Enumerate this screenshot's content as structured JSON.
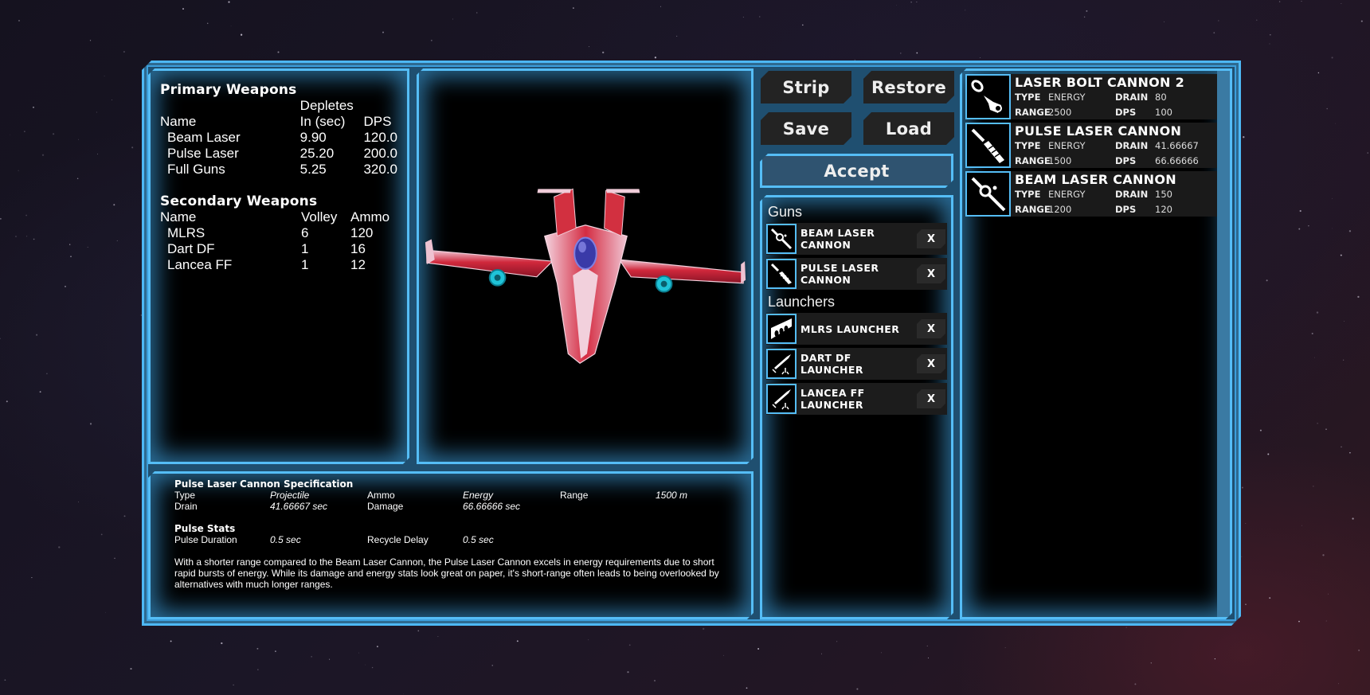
{
  "colors": {
    "frame_accent": "#55bdf6",
    "panel_bg": "#000000",
    "button_bg": "#232323",
    "accept_bg": "#2f5370"
  },
  "primary_weapons": {
    "title": "Primary Weapons",
    "header_top": [
      "",
      "Depletes",
      ""
    ],
    "headers": [
      "Name",
      "In (sec)",
      "DPS"
    ],
    "rows": [
      {
        "name": "Beam Laser",
        "depletes": "9.90",
        "dps": "120.0"
      },
      {
        "name": "Pulse Laser",
        "depletes": "25.20",
        "dps": "200.0"
      },
      {
        "name": "Full Guns",
        "depletes": "5.25",
        "dps": "320.0"
      }
    ]
  },
  "secondary_weapons": {
    "title": "Secondary Weapons",
    "headers": [
      "Name",
      "Volley",
      "Ammo"
    ],
    "rows": [
      {
        "name": "MLRS",
        "volley": "6",
        "ammo": "120"
      },
      {
        "name": "Dart DF",
        "volley": "1",
        "ammo": "16"
      },
      {
        "name": "Lancea FF",
        "volley": "1",
        "ammo": "12"
      }
    ]
  },
  "actions": {
    "strip": "Strip",
    "restore": "Restore",
    "save": "Save",
    "load": "Load",
    "accept": "Accept"
  },
  "loadout": {
    "guns_label": "Guns",
    "guns": [
      {
        "name": "BEAM LASER CANNON",
        "icon": "beam-laser-icon",
        "remove": "X"
      },
      {
        "name": "PULSE LASER CANNON",
        "icon": "pulse-laser-icon",
        "remove": "X"
      }
    ],
    "launchers_label": "Launchers",
    "launchers": [
      {
        "name": "MLRS LAUNCHER",
        "icon": "mlrs-icon",
        "remove": "X"
      },
      {
        "name": "DART DF LAUNCHER",
        "icon": "missile-launcher-icon",
        "remove": "X"
      },
      {
        "name": "LANCEA FF LAUNCHER",
        "icon": "missile-launcher-icon",
        "remove": "X"
      }
    ]
  },
  "inventory": {
    "labels": {
      "type": "TYPE",
      "drain": "DRAIN",
      "range": "RANGE",
      "dps": "DPS"
    },
    "items": [
      {
        "name": "LASER BOLT CANNON 2",
        "icon": "laser-bolt-icon",
        "type": "ENERGY",
        "drain": "80",
        "range": "2500",
        "dps": "100"
      },
      {
        "name": "PULSE LASER CANNON",
        "icon": "pulse-laser-icon",
        "type": "ENERGY",
        "drain": "41.66667",
        "range": "1500",
        "dps": "66.66666"
      },
      {
        "name": "BEAM LASER CANNON",
        "icon": "beam-laser-icon",
        "type": "ENERGY",
        "drain": "150",
        "range": "1200",
        "dps": "120"
      }
    ]
  },
  "spec": {
    "title": "Pulse Laser Cannon Specification",
    "type_label": "Type",
    "type_value": "Projectile",
    "ammo_label": "Ammo",
    "ammo_value": "Energy",
    "range_label": "Range",
    "range_value": "1500 m",
    "drain_label": "Drain",
    "drain_value": "41.66667 sec",
    "damage_label": "Damage",
    "damage_value": "66.66666 sec",
    "stats_title": "Pulse Stats",
    "pulse_duration_label": "Pulse Duration",
    "pulse_duration_value": "0.5 sec",
    "recycle_delay_label": "Recycle Delay",
    "recycle_delay_value": "0.5 sec",
    "description": "With a shorter range compared to the Beam Laser Cannon, the Pulse Laser Cannon excels in energy requirements due to short rapid bursts of energy. While its damage and energy stats look great on paper, it's short-range often leads to being overlooked by alternatives with much longer ranges."
  }
}
